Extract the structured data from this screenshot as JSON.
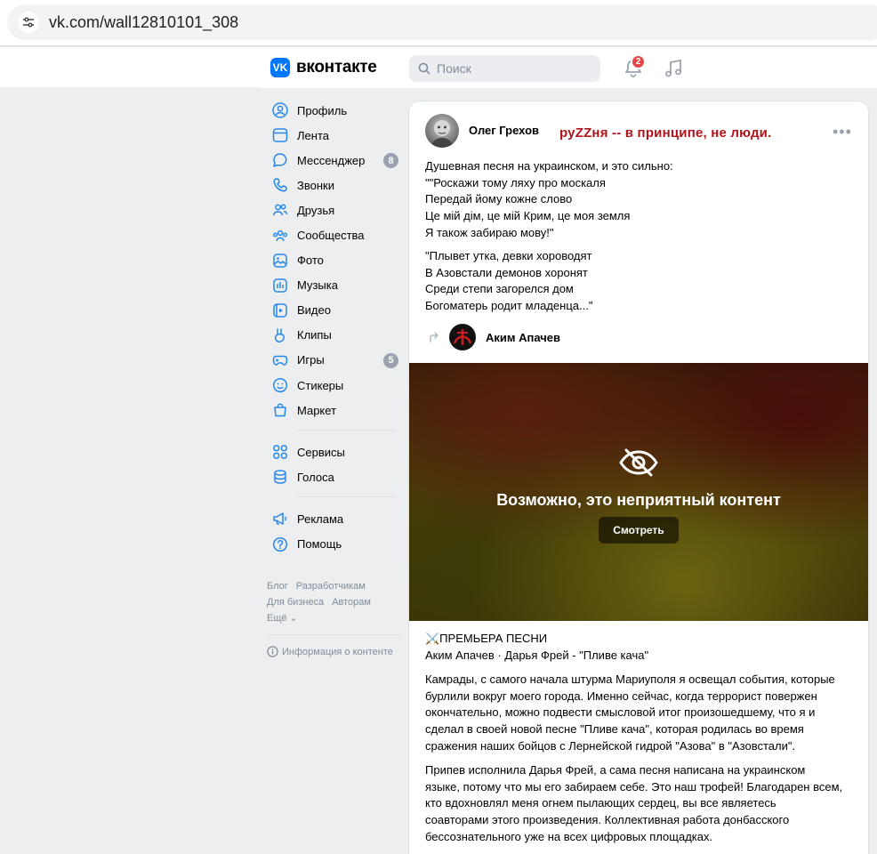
{
  "browser": {
    "url": "vk.com/wall12810101_308"
  },
  "header": {
    "logo_text": "вконтакте",
    "logo_mark": "VK",
    "search_placeholder": "Поиск",
    "notifications_count": "2"
  },
  "sidebar": {
    "items": [
      {
        "label": "Профиль",
        "icon": "user-icon"
      },
      {
        "label": "Лента",
        "icon": "news-icon"
      },
      {
        "label": "Мессенджер",
        "icon": "message-icon",
        "count": "8"
      },
      {
        "label": "Звонки",
        "icon": "phone-icon"
      },
      {
        "label": "Друзья",
        "icon": "friends-icon"
      },
      {
        "label": "Сообщества",
        "icon": "groups-icon"
      },
      {
        "label": "Фото",
        "icon": "photo-icon"
      },
      {
        "label": "Музыка",
        "icon": "music-icon"
      },
      {
        "label": "Видео",
        "icon": "video-icon"
      },
      {
        "label": "Клипы",
        "icon": "clips-icon"
      },
      {
        "label": "Игры",
        "icon": "games-icon",
        "count": "5"
      },
      {
        "label": "Стикеры",
        "icon": "stickers-icon"
      },
      {
        "label": "Маркет",
        "icon": "market-icon"
      }
    ],
    "items2": [
      {
        "label": "Сервисы",
        "icon": "services-icon"
      },
      {
        "label": "Голоса",
        "icon": "votes-icon"
      }
    ],
    "items3": [
      {
        "label": "Реклама",
        "icon": "ads-icon"
      },
      {
        "label": "Помощь",
        "icon": "help-icon"
      }
    ],
    "footer": {
      "blog": "Блог",
      "developers": "Разработчикам",
      "business": "Для бизнеса",
      "authors": "Авторам",
      "more": "Ещё ⌄",
      "info": "Информация о контенте"
    }
  },
  "post": {
    "author": "Олег Грехов",
    "status": "руZZня -- в принципе, не люди.",
    "more": "•••",
    "paragraph1": "Душевная песня на украинском, и это сильно:\n\"\"Роскажи тому ляху про москаля\nПередай йому кожне слово\nЦе мій дім, це мій Крим, це моя земля\nЯ також забираю мову!\"",
    "paragraph2": "\"Плывет утка, девки хороводят\nВ Азовстали демонов хоронят\nСреди степи загорелся дом\nБогоматерь родит младенца...\"",
    "repost_author": "Аким Апачев",
    "media_warning": "Возможно, это неприятный контент",
    "media_button": "Смотреть",
    "premiere_line1": "⚔️ПРЕМЬЕРА ПЕСНИ",
    "premiere_line2": "Аким Апачев · Дарья Фрей - \"Пливе кача\"",
    "paragraph3": "Камрады, с самого начала штурма Мариуполя я освещал события, которые\nбурлили вокруг моего города. Именно сейчас, когда террорист повержен\nокончательно, можно подвести смысловой итог произошедшему, что я и\nсделал в своей новой песне \"Пливе кача\", которая родилась во время\nсражения наших бойцов с Лернейской гидрой \"Азова\" в \"Азовстали\".",
    "paragraph4": "Припев исполнила Дарья Фрей, а сама песня написана на украинском\nязыке, потому что мы его забираем себе. Это наш трофей! Благодарен всем,\nкто вдохновлял меня огнем пылающих сердец, вы все являетесь\nсоавторами этого произведения. Коллективная работа донбасского\nбессознательного уже на всех цифровых площадках."
  }
}
